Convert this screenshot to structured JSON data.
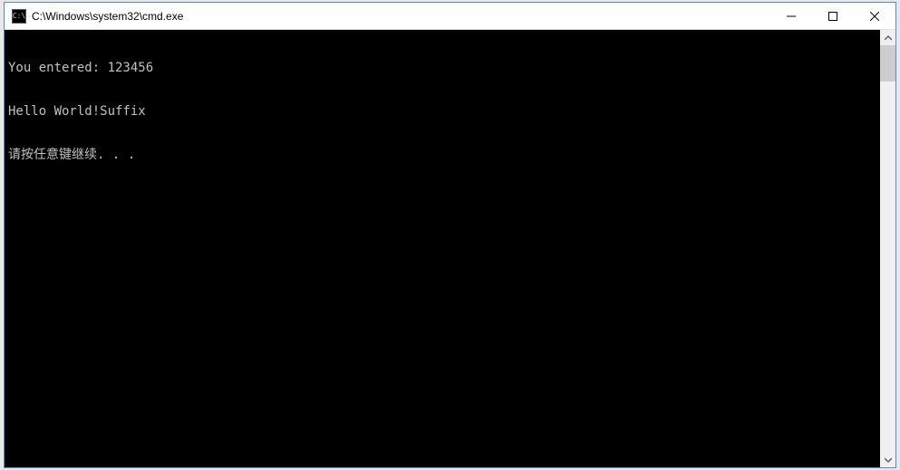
{
  "window": {
    "title": "C:\\Windows\\system32\\cmd.exe",
    "icon_label": "C:\\"
  },
  "console": {
    "lines": [
      "You entered: 123456",
      "Hello World!Suffix",
      "请按任意键继续. . ."
    ]
  }
}
